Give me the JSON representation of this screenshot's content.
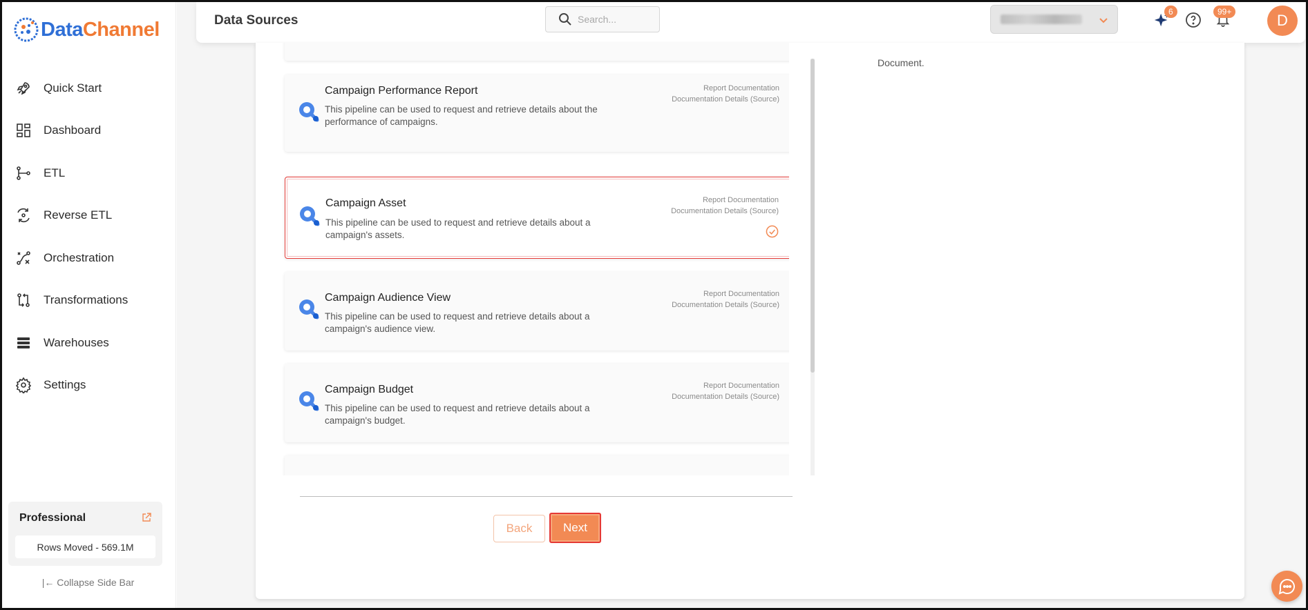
{
  "brand": {
    "name_part1": "Data",
    "name_part2": "Channel"
  },
  "sidebar": {
    "items": [
      {
        "label": "Quick Start",
        "icon": "rocket-icon"
      },
      {
        "label": "Dashboard",
        "icon": "dashboard-icon"
      },
      {
        "label": "ETL",
        "icon": "etl-icon"
      },
      {
        "label": "Reverse ETL",
        "icon": "reverse-etl-icon"
      },
      {
        "label": "Orchestration",
        "icon": "orchestration-icon"
      },
      {
        "label": "Transformations",
        "icon": "transformations-icon"
      },
      {
        "label": "Warehouses",
        "icon": "warehouses-icon"
      },
      {
        "label": "Settings",
        "icon": "settings-icon"
      }
    ],
    "plan": {
      "title": "Professional",
      "rows_moved": "Rows Moved - 569.1M"
    },
    "collapse_label": "|← Collapse Side Bar"
  },
  "header": {
    "title": "Data Sources",
    "search_placeholder": "Search...",
    "ai_badge": "6",
    "notifications_badge": "99+",
    "avatar_initial": "D"
  },
  "main": {
    "right_text": "Document.",
    "cards": [
      {
        "title": "Campaign Performance Report",
        "description": "This pipeline can be used to request and retrieve details about the performance of campaigns.",
        "link1": "Report Documentation",
        "link2": "Documentation Details (Source)",
        "selected": false
      },
      {
        "title": "Campaign Asset",
        "description": "This pipeline can be used to request and retrieve details about a campaign's assets.",
        "link1": "Report Documentation",
        "link2": "Documentation Details (Source)",
        "selected": true
      },
      {
        "title": "Campaign Audience View",
        "description": "This pipeline can be used to request and retrieve details about a campaign's audience view.",
        "link1": "Report Documentation",
        "link2": "Documentation Details (Source)",
        "selected": false
      },
      {
        "title": "Campaign Budget",
        "description": "This pipeline can be used to request and retrieve details about a campaign's budget.",
        "link1": "Report Documentation",
        "link2": "Documentation Details (Source)",
        "selected": false
      }
    ],
    "back_label": "Back",
    "next_label": "Next"
  },
  "colors": {
    "accent": "#f28a54",
    "brand_blue": "#2f6fd6",
    "selection": "#e53935"
  }
}
